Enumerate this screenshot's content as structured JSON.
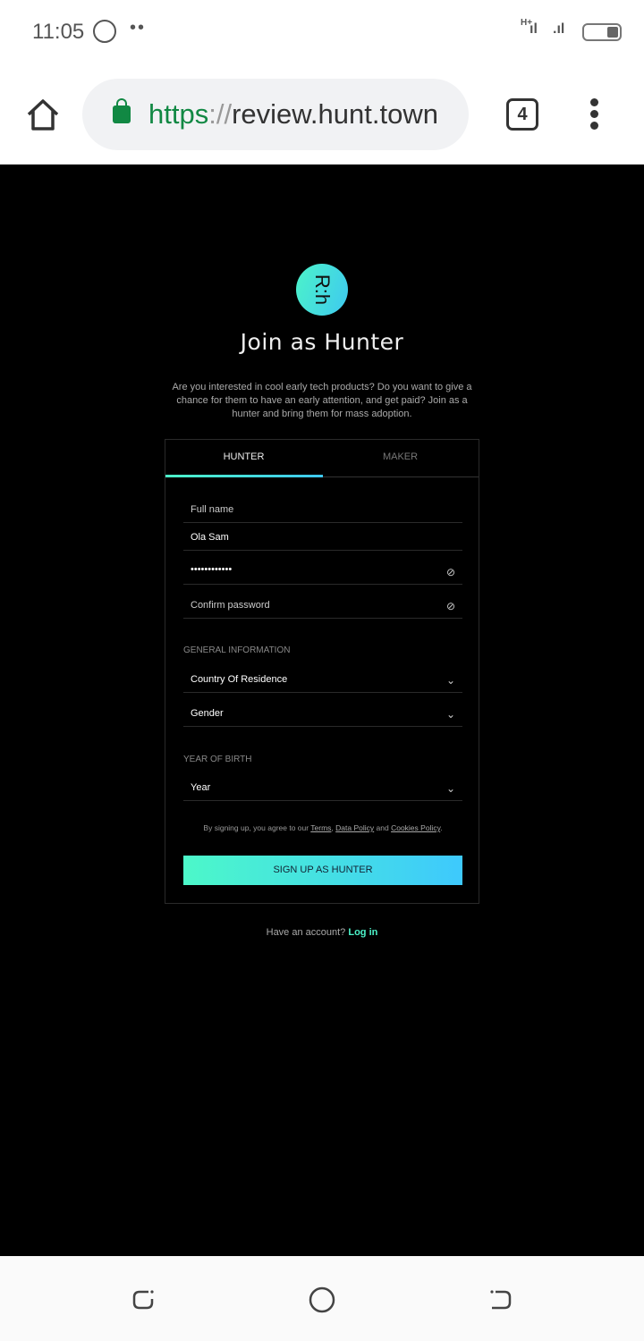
{
  "status_bar": {
    "time": "11:05",
    "notification_icons": [
      "whatsapp-icon",
      "more-dots"
    ],
    "network": "H+",
    "battery_icon": "battery-icon"
  },
  "browser": {
    "url_scheme": "https",
    "url_sep": "://",
    "url_host": "review.hunt.town",
    "tab_count": "4"
  },
  "page": {
    "logo_text": "R:h",
    "title": "Join as Hunter",
    "intro": "Are you interested in cool early tech products? Do you want to give a chance for them to have an early attention, and get paid? Join as a hunter and bring them for mass adoption.",
    "tabs": [
      {
        "label": "HUNTER",
        "active": true
      },
      {
        "label": "MAKER",
        "active": false
      }
    ],
    "form": {
      "full_name_label": "Full name",
      "name_value": "Ola Sam",
      "password_value": "••••••••••••",
      "confirm_password_placeholder": "Confirm password",
      "general_info_heading": "GENERAL INFORMATION",
      "country_placeholder": "Country Of Residence",
      "gender_placeholder": "Gender",
      "year_heading": "YEAR OF BIRTH",
      "year_placeholder": "Year",
      "terms_prefix": "By signing up, you agree to our ",
      "terms_link": "Terms",
      "comma": ", ",
      "data_policy_link": "Data Policy",
      "and": " and ",
      "cookies_link": "Cookies Policy",
      "period": ".",
      "submit_label": "SIGN UP AS HUNTER"
    },
    "login_prompt": "Have an account? ",
    "login_link": "Log in"
  },
  "colors": {
    "accent_start": "#4cf3c9",
    "accent_end": "#3ec9f0",
    "background": "#000000",
    "lock_green": "#118843"
  }
}
